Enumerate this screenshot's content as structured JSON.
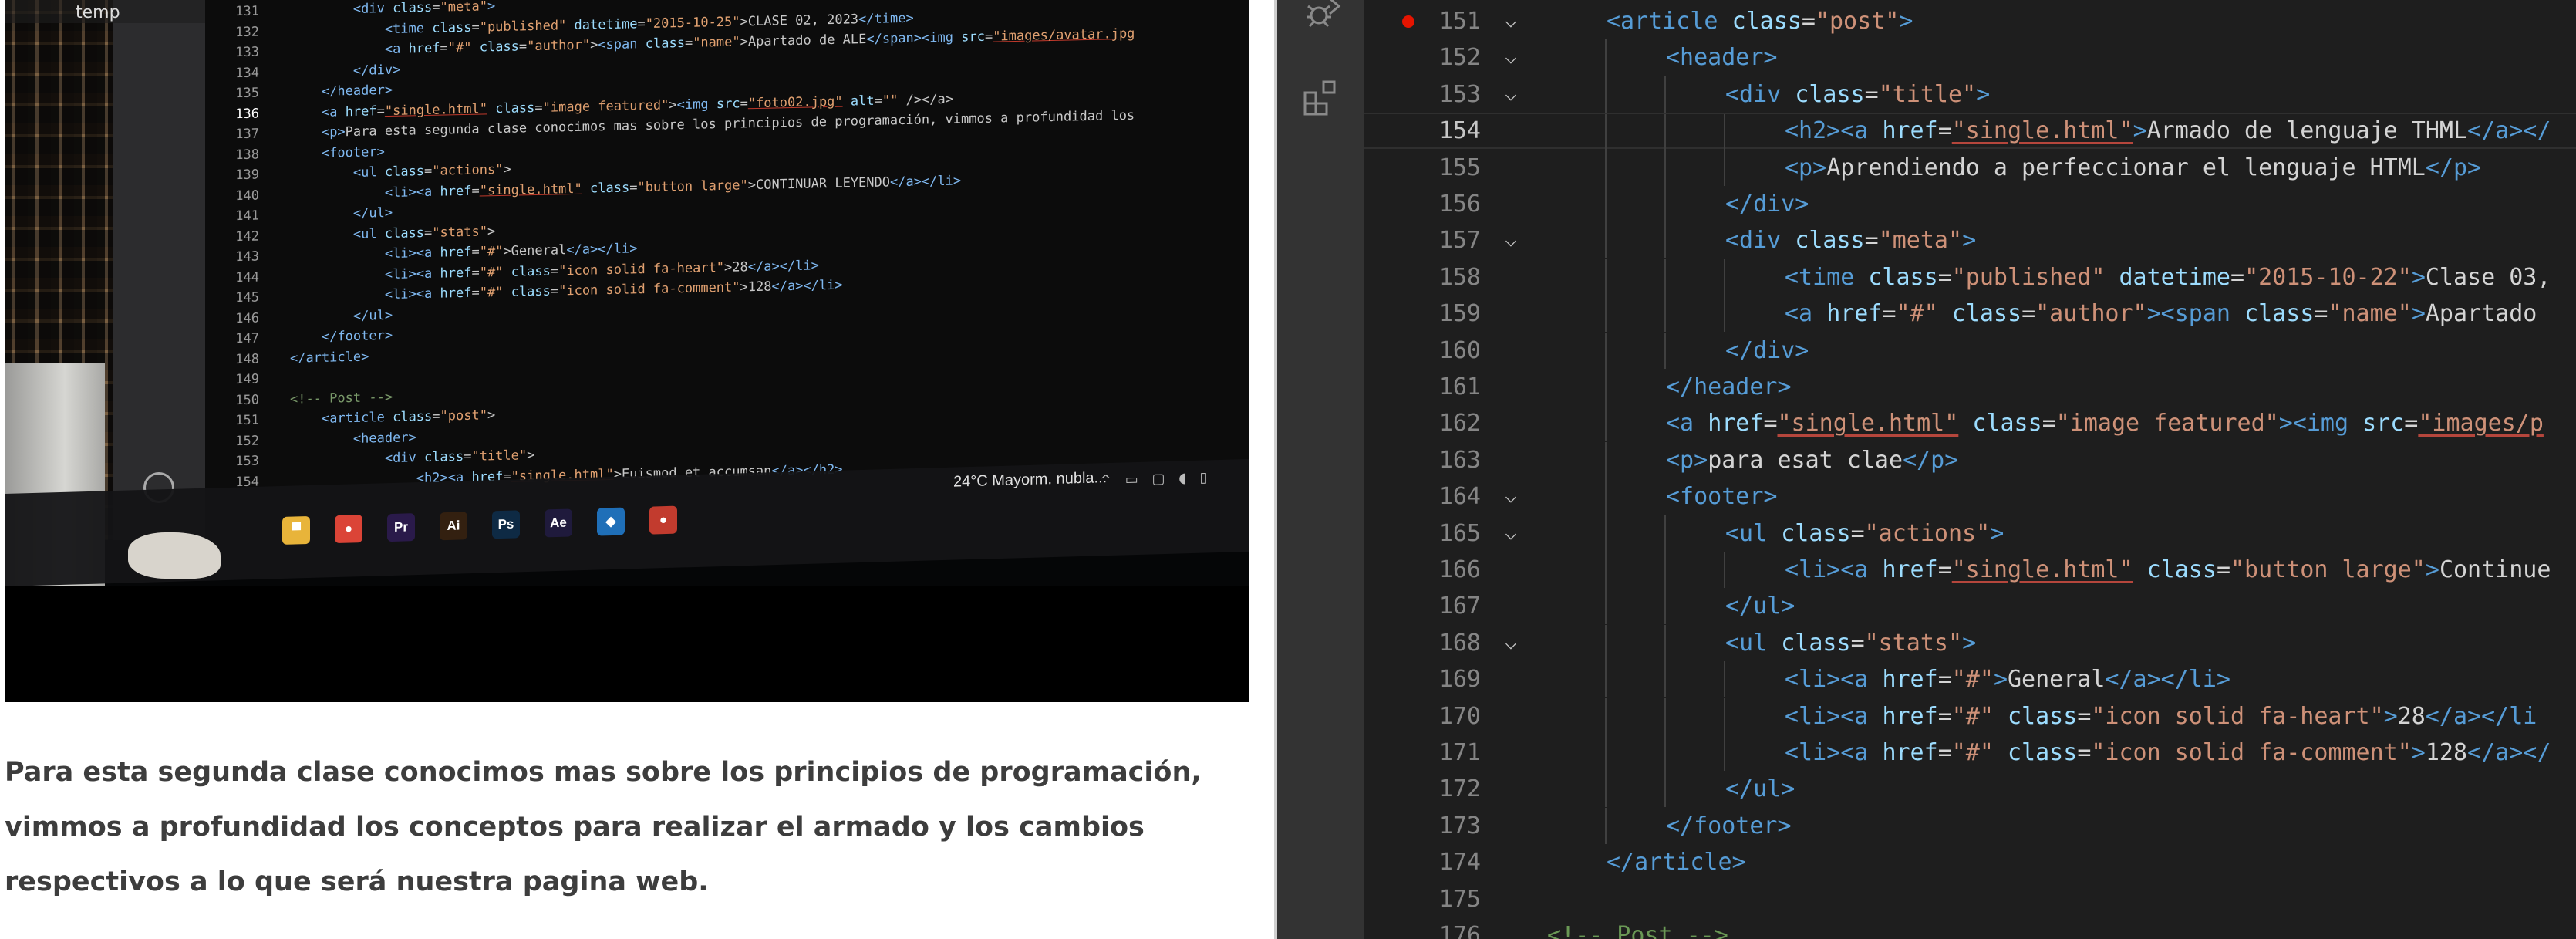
{
  "left": {
    "photo": {
      "sidebar_label": "temp",
      "code_lines": [
        {
          "n": "131",
          "html": "        <span class=\"pt\">&lt;div</span> <span class=\"pa\">class</span>=<span class=\"pv\">\"meta\"</span><span class=\"pt\">&gt;</span>"
        },
        {
          "n": "132",
          "html": "            <span class=\"pt\">&lt;time</span> <span class=\"pa\">class</span>=<span class=\"pv\">\"published\"</span> <span class=\"pa\">datetime</span>=<span class=\"pv\">\"2015-10-25\"</span>&gt;CLASE 02, 2023<span class=\"pt\">&lt;/time&gt;</span>"
        },
        {
          "n": "133",
          "html": "            <span class=\"pt\">&lt;a</span> <span class=\"pa\">href</span>=<span class=\"pv\">\"#\"</span> <span class=\"pa\">class</span>=<span class=\"pv\">\"author\"</span>&gt;<span class=\"pt\">&lt;span</span> <span class=\"pa\">class</span>=<span class=\"pv\">\"name\"</span>&gt;Apartado de ALE<span class=\"pt\">&lt;/span&gt;&lt;img</span> <span class=\"pa\">src</span>=<span class=\"pl\">\"images/avatar.jpg</span>"
        },
        {
          "n": "134",
          "html": "        <span class=\"pt\">&lt;/div&gt;</span>"
        },
        {
          "n": "135",
          "html": "    <span class=\"pt\">&lt;/header&gt;</span>"
        },
        {
          "n": "136",
          "html": "    <span class=\"pt\">&lt;a</span> <span class=\"pa\">href</span>=<span class=\"pl\">\"single.html\"</span> <span class=\"pa\">class</span>=<span class=\"pv\">\"image featured\"</span>&gt;<span class=\"pt\">&lt;img</span> <span class=\"pa\">src</span>=<span class=\"pl\">\"foto02.jpg\"</span> <span class=\"pa\">alt</span>=<span class=\"pv\">\"\"</span> /&gt;&lt;/a&gt;",
          "cur": true
        },
        {
          "n": "137",
          "html": "    <span class=\"pt\">&lt;p&gt;</span>Para esta segunda clase conocimos mas sobre los principios de programación, vimmos a profundidad los"
        },
        {
          "n": "138",
          "html": "    <span class=\"pt\">&lt;footer&gt;</span>"
        },
        {
          "n": "139",
          "html": "        <span class=\"pt\">&lt;ul</span> <span class=\"pa\">class</span>=<span class=\"pv\">\"actions\"</span>&gt;"
        },
        {
          "n": "140",
          "html": "            <span class=\"pt\">&lt;li&gt;&lt;a</span> <span class=\"pa\">href</span>=<span class=\"pl\">\"single.html\"</span> <span class=\"pa\">class</span>=<span class=\"pv\">\"button large\"</span>&gt;CONTINUAR LEYENDO<span class=\"pt\">&lt;/a&gt;&lt;/li&gt;</span>"
        },
        {
          "n": "141",
          "html": "        <span class=\"pt\">&lt;/ul&gt;</span>"
        },
        {
          "n": "142",
          "html": "        <span class=\"pt\">&lt;ul</span> <span class=\"pa\">class</span>=<span class=\"pv\">\"stats\"</span>&gt;"
        },
        {
          "n": "143",
          "html": "            <span class=\"pt\">&lt;li&gt;&lt;a</span> <span class=\"pa\">href</span>=<span class=\"pv\">\"#\"</span>&gt;General<span class=\"pt\">&lt;/a&gt;&lt;/li&gt;</span>"
        },
        {
          "n": "144",
          "html": "            <span class=\"pt\">&lt;li&gt;&lt;a</span> <span class=\"pa\">href</span>=<span class=\"pv\">\"#\"</span> <span class=\"pa\">class</span>=<span class=\"pv\">\"icon solid fa-heart\"</span>&gt;28<span class=\"pt\">&lt;/a&gt;&lt;/li&gt;</span>"
        },
        {
          "n": "145",
          "html": "            <span class=\"pt\">&lt;li&gt;&lt;a</span> <span class=\"pa\">href</span>=<span class=\"pv\">\"#\"</span> <span class=\"pa\">class</span>=<span class=\"pv\">\"icon solid fa-comment\"</span>&gt;128<span class=\"pt\">&lt;/a&gt;&lt;/li&gt;</span>"
        },
        {
          "n": "146",
          "html": "        <span class=\"pt\">&lt;/ul&gt;</span>"
        },
        {
          "n": "147",
          "html": "    <span class=\"pt\">&lt;/footer&gt;</span>"
        },
        {
          "n": "148",
          "html": "<span class=\"pt\">&lt;/article&gt;</span>"
        },
        {
          "n": "149",
          "html": ""
        },
        {
          "n": "150",
          "html": "<span class=\"pc\">&lt;!-- Post --&gt;</span>"
        },
        {
          "n": "151",
          "html": "    <span class=\"pt\">&lt;article</span> <span class=\"pa\">class</span>=<span class=\"pv\">\"post\"</span>&gt;"
        },
        {
          "n": "152",
          "html": "        <span class=\"pt\">&lt;header&gt;</span>"
        },
        {
          "n": "153",
          "html": "            <span class=\"pt\">&lt;div</span> <span class=\"pa\">class</span>=<span class=\"pv\">\"title\"</span>&gt;"
        },
        {
          "n": "154",
          "html": "                <span class=\"pt\">&lt;h2&gt;&lt;a</span> <span class=\"pa\">href</span>=<span class=\"pl\">\"single.html\"</span>&gt;Euismod et accumsan<span class=\"pt\">&lt;/a&gt;&lt;/h2&gt;</span>"
        }
      ],
      "weather": "24°C  Mayorm. nubla...",
      "taskbar_apps": [
        {
          "name": "file-explorer",
          "label": "▀",
          "color": "#e8b43a"
        },
        {
          "name": "chrome",
          "label": "●",
          "color": "#db4437"
        },
        {
          "name": "premiere",
          "label": "Pr",
          "color": "#2a1a4a"
        },
        {
          "name": "illustrator",
          "label": "Ai",
          "color": "#332010"
        },
        {
          "name": "photoshop",
          "label": "Ps",
          "color": "#0e2a44"
        },
        {
          "name": "after-effects",
          "label": "Ae",
          "color": "#1f1a3c"
        },
        {
          "name": "vscode",
          "label": "◆",
          "color": "#1f6fb8"
        },
        {
          "name": "chrome-alt",
          "label": "●",
          "color": "#c23b2e"
        }
      ]
    },
    "post_text": "Para esta segunda clase conocimos mas sobre los principios de programación, vimmos a profundidad los conceptos para realizar el armado y los cambios respectivos a lo que será nuestra pagina web."
  },
  "editor": {
    "activity_icons": [
      "debug-icon",
      "extensions-icon"
    ],
    "lines": [
      {
        "n": "151",
        "fold": "v",
        "bp": true,
        "indent": 1,
        "html": "<span class=\"t\">&lt;article</span> <span class=\"a\">class</span>=<span class=\"v\">\"post\"</span><span class=\"t\">&gt;</span>"
      },
      {
        "n": "152",
        "fold": "v",
        "indent": 2,
        "html": "<span class=\"t\">&lt;header&gt;</span>"
      },
      {
        "n": "153",
        "fold": "v",
        "indent": 3,
        "html": "<span class=\"t\">&lt;div</span> <span class=\"a\">class</span>=<span class=\"v\">\"title\"</span><span class=\"t\">&gt;</span>"
      },
      {
        "n": "154",
        "cur": true,
        "indent": 4,
        "html": "<span class=\"t\">&lt;h2&gt;&lt;a</span> <span class=\"a\">href</span>=<span class=\"l\">\"single.html\"</span><span class=\"t\">&gt;</span><span class=\"x\">Armado de lenguaje THML</span><span class=\"t\">&lt;/a&gt;&lt;/</span>"
      },
      {
        "n": "155",
        "indent": 4,
        "html": "<span class=\"t\">&lt;p&gt;</span><span class=\"x\">Aprendiendo a perfeccionar el lenguaje HTML</span><span class=\"t\">&lt;/p&gt;</span>"
      },
      {
        "n": "156",
        "indent": 3,
        "html": "<span class=\"t\">&lt;/div&gt;</span>"
      },
      {
        "n": "157",
        "fold": "v",
        "indent": 3,
        "html": "<span class=\"t\">&lt;div</span> <span class=\"a\">class</span>=<span class=\"v\">\"meta\"</span><span class=\"t\">&gt;</span>"
      },
      {
        "n": "158",
        "indent": 4,
        "html": "<span class=\"t\">&lt;time</span> <span class=\"a\">class</span>=<span class=\"v\">\"published\"</span> <span class=\"a\">datetime</span>=<span class=\"v\">\"2015-10-22\"</span><span class=\"t\">&gt;</span><span class=\"x\">Clase 03,</span>"
      },
      {
        "n": "159",
        "indent": 4,
        "html": "<span class=\"t\">&lt;a</span> <span class=\"a\">href</span>=<span class=\"v\">\"#\"</span> <span class=\"a\">class</span>=<span class=\"v\">\"author\"</span><span class=\"t\">&gt;&lt;span</span> <span class=\"a\">class</span>=<span class=\"v\">\"name\"</span><span class=\"t\">&gt;</span><span class=\"x\">Apartado</span>"
      },
      {
        "n": "160",
        "indent": 3,
        "html": "<span class=\"t\">&lt;/div&gt;</span>"
      },
      {
        "n": "161",
        "indent": 2,
        "html": "<span class=\"t\">&lt;/header&gt;</span>"
      },
      {
        "n": "162",
        "indent": 2,
        "html": "<span class=\"t\">&lt;a</span> <span class=\"a\">href</span>=<span class=\"l\">\"single.html\"</span> <span class=\"a\">class</span>=<span class=\"v\">\"image featured\"</span><span class=\"t\">&gt;&lt;img</span> <span class=\"a\">src</span>=<span class=\"l\">\"images/p</span>"
      },
      {
        "n": "163",
        "indent": 2,
        "html": "<span class=\"t\">&lt;p&gt;</span><span class=\"x\">para esat clae</span><span class=\"t\">&lt;/p&gt;</span>"
      },
      {
        "n": "164",
        "fold": "v",
        "indent": 2,
        "html": "<span class=\"t\">&lt;footer&gt;</span>"
      },
      {
        "n": "165",
        "fold": "v",
        "indent": 3,
        "html": "<span class=\"t\">&lt;ul</span> <span class=\"a\">class</span>=<span class=\"v\">\"actions\"</span><span class=\"t\">&gt;</span>"
      },
      {
        "n": "166",
        "indent": 4,
        "html": "<span class=\"t\">&lt;li&gt;&lt;a</span> <span class=\"a\">href</span>=<span class=\"l\">\"single.html\"</span> <span class=\"a\">class</span>=<span class=\"v\">\"button large\"</span><span class=\"t\">&gt;</span><span class=\"x\">Continue</span>"
      },
      {
        "n": "167",
        "indent": 3,
        "html": "<span class=\"t\">&lt;/ul&gt;</span>"
      },
      {
        "n": "168",
        "fold": "v",
        "indent": 3,
        "html": "<span class=\"t\">&lt;ul</span> <span class=\"a\">class</span>=<span class=\"v\">\"stats\"</span><span class=\"t\">&gt;</span>"
      },
      {
        "n": "169",
        "indent": 4,
        "html": "<span class=\"t\">&lt;li&gt;&lt;a</span> <span class=\"a\">href</span>=<span class=\"v\">\"#\"</span><span class=\"t\">&gt;</span><span class=\"x\">General</span><span class=\"t\">&lt;/a&gt;&lt;/li&gt;</span>"
      },
      {
        "n": "170",
        "indent": 4,
        "html": "<span class=\"t\">&lt;li&gt;&lt;a</span> <span class=\"a\">href</span>=<span class=\"v\">\"#\"</span> <span class=\"a\">class</span>=<span class=\"v\">\"icon solid fa-heart\"</span><span class=\"t\">&gt;</span><span class=\"x\">28</span><span class=\"t\">&lt;/a&gt;&lt;/li</span>"
      },
      {
        "n": "171",
        "indent": 4,
        "html": "<span class=\"t\">&lt;li&gt;&lt;a</span> <span class=\"a\">href</span>=<span class=\"v\">\"#\"</span> <span class=\"a\">class</span>=<span class=\"v\">\"icon solid fa-comment\"</span><span class=\"t\">&gt;</span><span class=\"x\">128</span><span class=\"t\">&lt;/a&gt;&lt;/</span>"
      },
      {
        "n": "172",
        "indent": 3,
        "html": "<span class=\"t\">&lt;/ul&gt;</span>"
      },
      {
        "n": "173",
        "indent": 2,
        "html": "<span class=\"t\">&lt;/footer&gt;</span>"
      },
      {
        "n": "174",
        "indent": 1,
        "html": "<span class=\"t\">&lt;/article&gt;</span>"
      },
      {
        "n": "175",
        "indent": 0,
        "html": ""
      },
      {
        "n": "176",
        "indent": 0,
        "html": "<span class=\"c\">&lt;!-- Post --&gt;</span>"
      }
    ]
  }
}
